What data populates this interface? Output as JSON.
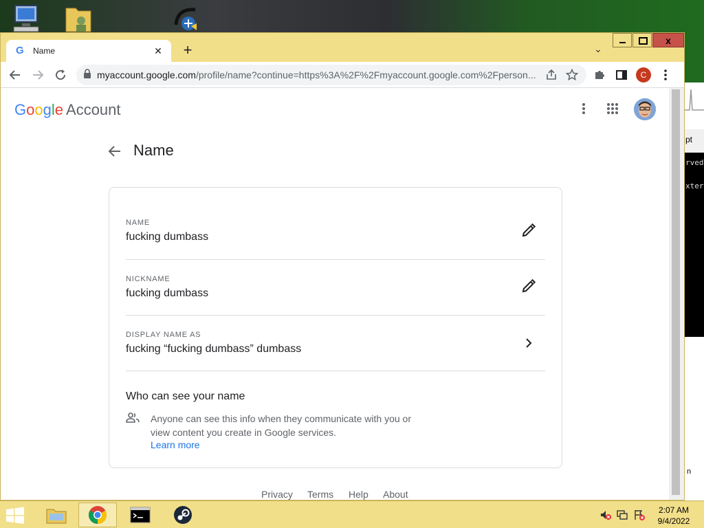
{
  "desktop": {
    "icons": [
      "computer-icon",
      "user-folder-icon",
      "network-icon"
    ]
  },
  "background_window": {
    "title_fragment": "pt",
    "lines": [
      "rved",
      "xter"
    ],
    "lower_fragment": "n"
  },
  "browser": {
    "tab": {
      "title": "Name",
      "favicon": "G"
    },
    "window_controls": {
      "close": "x"
    },
    "address": {
      "host": "myaccount.google.com",
      "path": "/profile/name?continue=https%3A%2F%2Fmyaccount.google.com%2Fperson..."
    },
    "profile_initial": "C"
  },
  "header": {
    "logo_letters": [
      "G",
      "o",
      "o",
      "g",
      "l",
      "e"
    ],
    "logo_colors": [
      "#4285f4",
      "#ea4335",
      "#fbbc05",
      "#4285f4",
      "#34a853",
      "#ea4335"
    ],
    "account_label": "Account"
  },
  "page": {
    "title": "Name",
    "fields": [
      {
        "label": "NAME",
        "value": "fucking dumbass",
        "action_icon": "pencil-icon"
      },
      {
        "label": "NICKNAME",
        "value": "fucking dumbass",
        "action_icon": "pencil-icon"
      },
      {
        "label": "DISPLAY NAME AS",
        "value": "fucking “fucking dumbass” dumbass",
        "action_icon": "chevron-right-icon"
      }
    ],
    "visibility": {
      "title": "Who can see your name",
      "text": "Anyone can see this info when they communicate with you or view content you create in Google services.",
      "link": "Learn more"
    },
    "footer": [
      "Privacy",
      "Terms",
      "Help",
      "About"
    ]
  },
  "taskbar": {
    "apps": [
      "file-explorer-icon",
      "chrome-icon",
      "command-prompt-icon",
      "steam-icon"
    ],
    "clock": {
      "time": "2:07 AM",
      "date": "9/4/2022"
    }
  }
}
